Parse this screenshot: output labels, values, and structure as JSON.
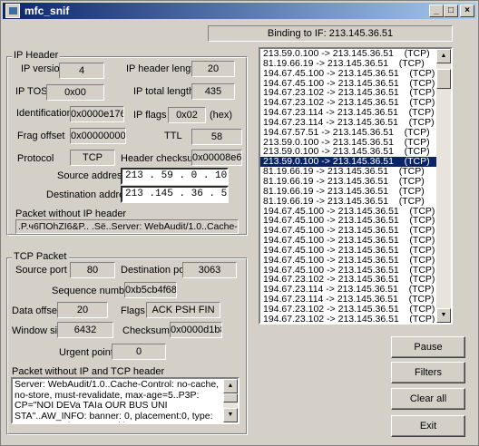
{
  "window": {
    "title": "mfc_snif",
    "min_label": "_",
    "max_label": "□",
    "close_label": "×"
  },
  "binding_status": "Binding to IF: 213.145.36.51",
  "ip_header": {
    "group_title": "IP Header",
    "version_label": "IP version",
    "version": "4",
    "header_length_label": "IP header length",
    "header_length": "20",
    "tos_label": "IP TOS",
    "tos": "0x00",
    "total_length_label": "IP total length",
    "total_length": "435",
    "identification_label": "Identification",
    "identification": "0x0000e176",
    "flags_label": "IP flags",
    "flags": "0x02",
    "flags_unit": "(hex)",
    "frag_offset_label": "Frag offset",
    "frag_offset": "0x00000000",
    "ttl_label": "TTL",
    "ttl": "58",
    "protocol_label": "Protocol",
    "protocol": "TCP",
    "checksum_label": "Header checksum",
    "checksum": "0x00008e6a",
    "source_label": "Source address",
    "source": "213 . 59 . 0 . 100",
    "dest_label": "Destination address",
    "dest": "213 .145 . 36 . 51",
    "payload_label": "Packet without IP header",
    "payload": ".P.ч6ПОhZI6&P.. .Së..Server: WebAudit/1.0..Cache-Control"
  },
  "tcp_packet": {
    "group_title": "TCP Packet",
    "source_port_label": "Source port",
    "source_port": "80",
    "dest_port_label": "Destination port",
    "dest_port": "3063",
    "seq_label": "Sequence number",
    "seq": "0xb5cb4f68",
    "data_offset_label": "Data offset",
    "data_offset": "20",
    "flags_label": "Flags",
    "flags": "ACK PSH FIN",
    "window_label": "Window size",
    "window": "6432",
    "checksum_label": "Checksum",
    "checksum": "0x0000d1b8",
    "urgent_label": "Urgent pointer",
    "urgent": "0",
    "payload_label": "Packet without IP and TCP header",
    "payload": "Server: WebAudit/1.0..Cache-Control: no-cache, no-store, must-revalidate, max-age=5..P3P: CP=\"NOI DEVa TAIa OUR BUS UNI STA\"..AW_INFO: banner: 0, placement:0, type: 130, serverId 5..Set-Cookie:"
  },
  "packets": [
    "213.59.0.100 -> 213.145.36.51    (TCP)",
    "81.19.66.19 -> 213.145.36.51    (TCP)",
    "194.67.45.100 -> 213.145.36.51    (TCP)",
    "194.67.45.100 -> 213.145.36.51    (TCP)",
    "194.67.23.102 -> 213.145.36.51    (TCP)",
    "194.67.23.102 -> 213.145.36.51    (TCP)",
    "194.67.23.114 -> 213.145.36.51    (TCP)",
    "194.67.23.114 -> 213.145.36.51    (TCP)",
    "194.67.57.51 -> 213.145.36.51    (TCP)",
    "213.59.0.100 -> 213.145.36.51    (TCP)",
    "213.59.0.100 -> 213.145.36.51    (TCP)",
    "213.59.0.100 -> 213.145.36.51    (TCP)",
    "81.19.66.19 -> 213.145.36.51    (TCP)",
    "81.19.66.19 -> 213.145.36.51    (TCP)",
    "81.19.66.19 -> 213.145.36.51    (TCP)",
    "81.19.66.19 -> 213.145.36.51    (TCP)",
    "194.67.45.100 -> 213.145.36.51    (TCP)",
    "194.67.45.100 -> 213.145.36.51    (TCP)",
    "194.67.45.100 -> 213.145.36.51    (TCP)",
    "194.67.45.100 -> 213.145.36.51    (TCP)",
    "194.67.45.100 -> 213.145.36.51    (TCP)",
    "194.67.45.100 -> 213.145.36.51    (TCP)",
    "194.67.45.100 -> 213.145.36.51    (TCP)",
    "194.67.23.102 -> 213.145.36.51    (TCP)",
    "194.67.23.114 -> 213.145.36.51    (TCP)",
    "194.67.23.114 -> 213.145.36.51    (TCP)",
    "194.67.23.102 -> 213.145.36.51    (TCP)",
    "194.67.23.102 -> 213.145.36.51    (TCP)",
    "194.67.23.102 -> 213.145.36.51    (TCP)",
    "194.67.23.102 -> 213.145.36.51    (TCP)"
  ],
  "selected_packet": 11,
  "buttons": {
    "pause": "Pause",
    "filters": "Filters",
    "clear_all": "Clear all",
    "exit": "Exit"
  },
  "colors": {
    "title_bar": "#0a246a",
    "selection": "#0a246a",
    "face": "#d4d0c8"
  },
  "icons": {
    "app": "app-icon",
    "scroll_up": "scroll-up-icon",
    "scroll_down": "scroll-down-icon"
  }
}
